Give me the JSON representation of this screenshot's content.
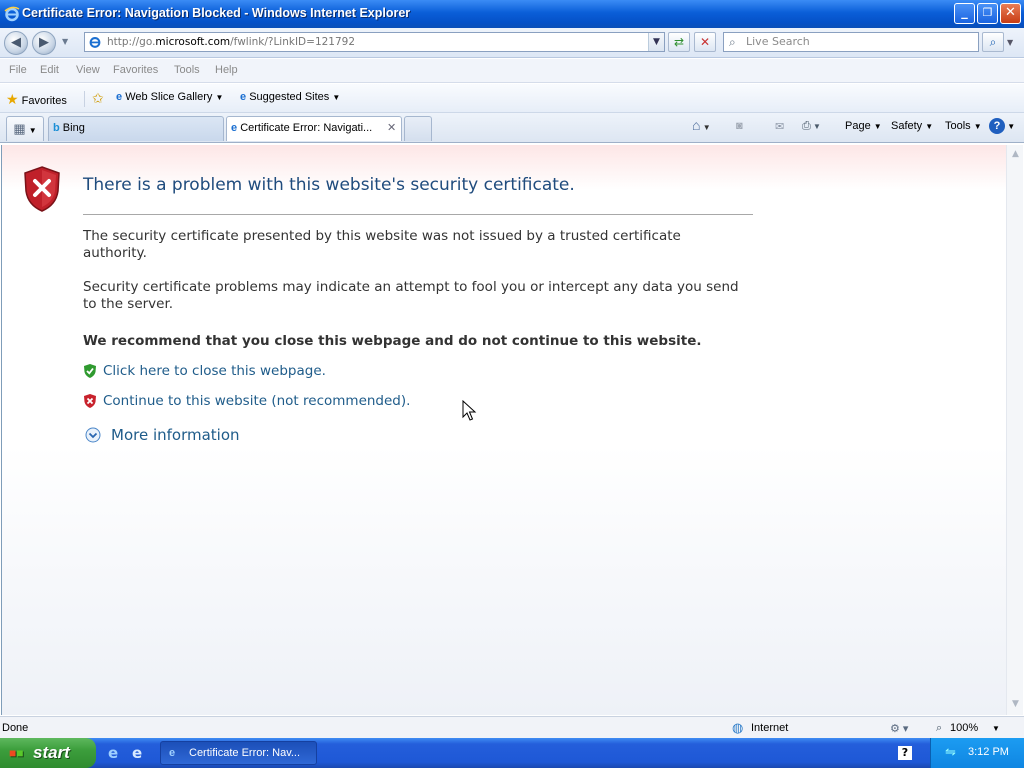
{
  "window": {
    "title": "Certificate Error: Navigation Blocked - Windows Internet Explorer",
    "minimize": "_",
    "restore": "❐",
    "close": "✕"
  },
  "address": {
    "url_prefix": "http://go.",
    "url_domain": "microsoft.com",
    "url_path": "/fwlink/?LinkID=121792",
    "search_placeholder": "Live Search"
  },
  "menu": [
    "File",
    "Edit",
    "View",
    "Favorites",
    "Tools",
    "Help"
  ],
  "favorites_bar": {
    "favorites": "Favorites",
    "web_slice": "Web Slice Gallery",
    "suggested": "Suggested Sites"
  },
  "tabs": [
    {
      "label": "Bing"
    },
    {
      "label": "Certificate Error: Navigati..."
    }
  ],
  "command_bar": {
    "page": "Page",
    "safety": "Safety",
    "tools": "Tools"
  },
  "content": {
    "heading": "There is a problem with this website's security certificate.",
    "para1": "The security certificate presented by this website was not issued by a trusted certificate authority.",
    "para2": "Security certificate problems may indicate an attempt to fool you or intercept any data you send to the server.",
    "recommend": "We recommend that you close this webpage and do not continue to this website.",
    "close_link": "Click here to close this webpage.",
    "continue_link": "Continue to this website (not recommended).",
    "more_info": "More information"
  },
  "status": {
    "text": "Done",
    "zone": "Internet",
    "zoom": "100%"
  },
  "taskbar": {
    "start": "start",
    "task": "Certificate Error: Nav...",
    "time": "3:12 PM"
  },
  "colors": {
    "heading": "#1f4b7d",
    "link": "#1f5c8a",
    "titlebar": "#0a5ed8"
  }
}
